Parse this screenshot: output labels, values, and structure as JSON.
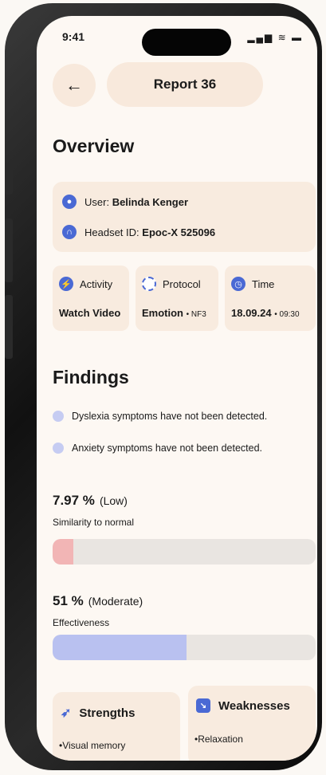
{
  "status": {
    "time": "9:41",
    "icons": "▂▄▆ ≋ ▬"
  },
  "header": {
    "title": "Report 36"
  },
  "overview": {
    "heading": "Overview",
    "user_label": "User:",
    "user_value": "Belinda Kenger",
    "headset_label": "Headset ID:",
    "headset_value": "Epoc-X 525096",
    "activity": {
      "label": "Activity",
      "value": "Watch Video"
    },
    "protocol": {
      "label": "Protocol",
      "value": "Emotion",
      "suffix": "• NF3"
    },
    "time": {
      "label": "Time",
      "value": "18.09.24",
      "suffix": "• 09:30"
    }
  },
  "findings": {
    "heading": "Findings",
    "items": [
      "Dyslexia symptoms have not been detected.",
      "Anxiety symptoms have not been detected."
    ]
  },
  "metrics": [
    {
      "value": "7.97 %",
      "level": "(Low)",
      "label": "Similarity to normal",
      "fraction": 0.0797,
      "color": "#f2b5b5"
    },
    {
      "value": "51 %",
      "level": "(Moderate)",
      "label": "Effectiveness",
      "fraction": 0.51,
      "color": "#b9c1f0"
    }
  ],
  "strengths": {
    "heading": "Strengths",
    "item": "•Visual memory"
  },
  "weaknesses": {
    "heading": "Weaknesses",
    "item": "•Relaxation"
  }
}
